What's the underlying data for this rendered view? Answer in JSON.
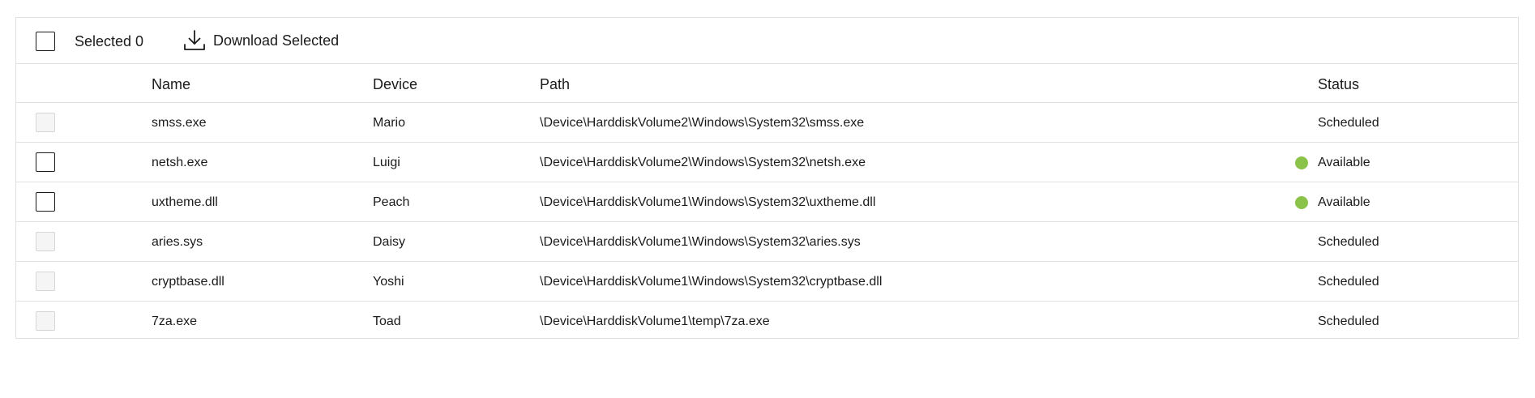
{
  "toolbar": {
    "selected_text": "Selected 0",
    "download_label": "Download Selected",
    "download_icon": "download-icon"
  },
  "columns": {
    "name": "Name",
    "device": "Device",
    "path": "Path",
    "status": "Status"
  },
  "colors": {
    "available_dot": "#8bc34a",
    "border": "#e1e1e1"
  },
  "rows": [
    {
      "name": "smss.exe",
      "device": "Mario",
      "path": "\\Device\\HarddiskVolume2\\Windows\\System32\\smss.exe",
      "status": "Scheduled",
      "selectable": false
    },
    {
      "name": "netsh.exe",
      "device": "Luigi",
      "path": "\\Device\\HarddiskVolume2\\Windows\\System32\\netsh.exe",
      "status": "Available",
      "selectable": true
    },
    {
      "name": "uxtheme.dll",
      "device": "Peach",
      "path": "\\Device\\HarddiskVolume1\\Windows\\System32\\uxtheme.dll",
      "status": "Available",
      "selectable": true
    },
    {
      "name": "aries.sys",
      "device": "Daisy",
      "path": "\\Device\\HarddiskVolume1\\Windows\\System32\\aries.sys",
      "status": "Scheduled",
      "selectable": false
    },
    {
      "name": "cryptbase.dll",
      "device": "Yoshi",
      "path": "\\Device\\HarddiskVolume1\\Windows\\System32\\cryptbase.dll",
      "status": "Scheduled",
      "selectable": false
    },
    {
      "name": "7za.exe",
      "device": "Toad",
      "path": "\\Device\\HarddiskVolume1\\temp\\7za.exe",
      "status": "Scheduled",
      "selectable": false
    }
  ]
}
